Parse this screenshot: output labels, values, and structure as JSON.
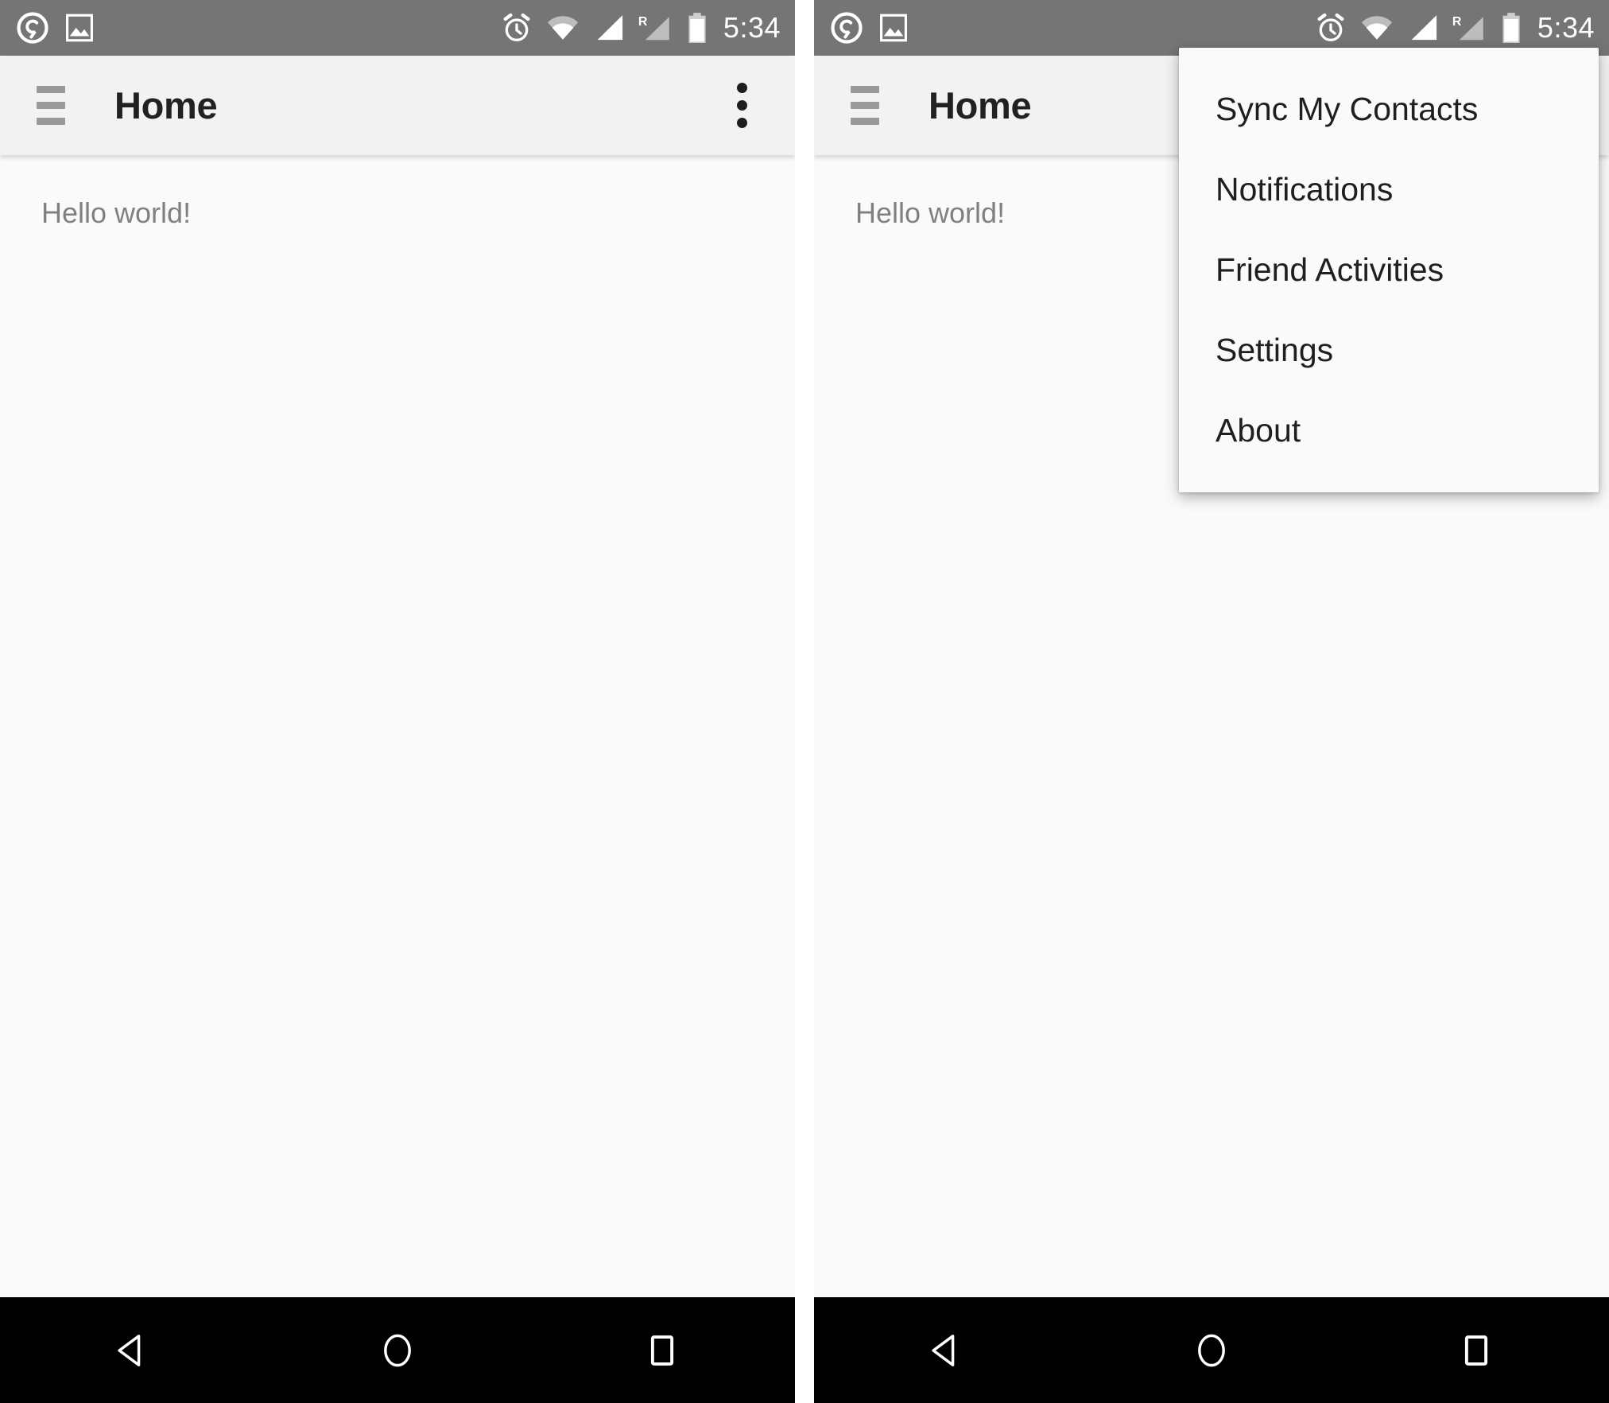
{
  "screens": [
    {
      "name": "home-closed",
      "status_bar": {
        "time": "5:34",
        "icons": [
          "app-logo-icon",
          "image-icon",
          "alarm-icon",
          "wifi-icon",
          "signal-icon",
          "signal-roaming-icon",
          "battery-icon"
        ],
        "roaming_label": "R",
        "background_color": "#757575"
      },
      "toolbar": {
        "menu_icon": "hamburger-icon",
        "title": "Home",
        "overflow_icon": "overflow-menu-icon",
        "background_color": "#f2f2f2",
        "title_color": "#212121"
      },
      "content": {
        "text": "Hello world!",
        "text_color": "#808080",
        "background_color": "#fafafa"
      },
      "menu_open": false,
      "nav_bar": {
        "buttons": [
          "back-button",
          "home-button",
          "recents-button"
        ],
        "background_color": "#000000"
      }
    },
    {
      "name": "home-menu-open",
      "status_bar": {
        "time": "5:34",
        "icons": [
          "app-logo-icon",
          "image-icon",
          "alarm-icon",
          "wifi-icon",
          "signal-icon",
          "signal-roaming-icon",
          "battery-icon"
        ],
        "roaming_label": "R",
        "background_color": "#757575"
      },
      "toolbar": {
        "menu_icon": "hamburger-icon",
        "title": "Home",
        "overflow_icon": "overflow-menu-icon",
        "background_color": "#f2f2f2",
        "title_color": "#212121"
      },
      "content": {
        "text": "Hello world!",
        "text_color": "#808080",
        "background_color": "#fafafa"
      },
      "menu_open": true,
      "overflow_menu": {
        "background_color": "#fafafa",
        "items": [
          {
            "label": "Sync My Contacts"
          },
          {
            "label": "Notifications"
          },
          {
            "label": "Friend Activities"
          },
          {
            "label": "Settings"
          },
          {
            "label": "About"
          }
        ]
      },
      "nav_bar": {
        "buttons": [
          "back-button",
          "home-button",
          "recents-button"
        ],
        "background_color": "#000000"
      }
    }
  ]
}
